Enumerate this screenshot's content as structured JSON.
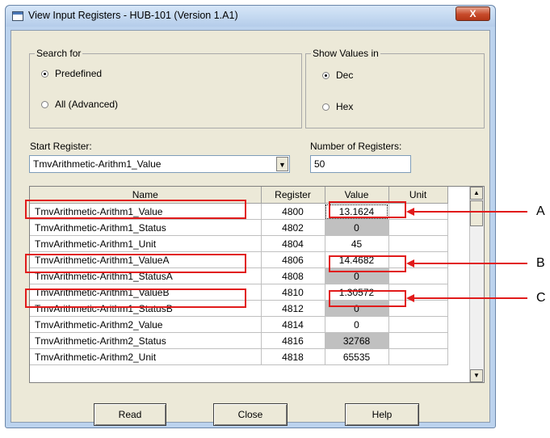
{
  "window": {
    "title": "View Input Registers - HUB-101 (Version 1.A1)",
    "close_glyph": "X"
  },
  "search_for": {
    "label": "Search for",
    "predefined_label": "Predefined",
    "all_label": "All (Advanced)",
    "selected": "Predefined"
  },
  "show_values": {
    "label": "Show Values in",
    "dec_label": "Dec",
    "hex_label": "Hex",
    "selected": "Dec"
  },
  "start_register": {
    "label": "Start Register:",
    "value": "TmvArithmetic-Arithm1_Value"
  },
  "num_registers": {
    "label": "Number of Registers:",
    "value": "50"
  },
  "table": {
    "headers": [
      "Name",
      "Register",
      "Value",
      "Unit"
    ],
    "rows": [
      {
        "name": "TmvArithmetic-Arithm1_Value",
        "register": "4800",
        "value": "13.1624",
        "unit": "",
        "grey": false
      },
      {
        "name": "TmvArithmetic-Arithm1_Status",
        "register": "4802",
        "value": "0",
        "unit": "",
        "grey": true
      },
      {
        "name": "TmvArithmetic-Arithm1_Unit",
        "register": "4804",
        "value": "45",
        "unit": "",
        "grey": false
      },
      {
        "name": "TmvArithmetic-Arithm1_ValueA",
        "register": "4806",
        "value": "14.4682",
        "unit": "",
        "grey": false
      },
      {
        "name": "TmvArithmetic-Arithm1_StatusA",
        "register": "4808",
        "value": "0",
        "unit": "",
        "grey": true
      },
      {
        "name": "TmvArithmetic-Arithm1_ValueB",
        "register": "4810",
        "value": "1.30572",
        "unit": "",
        "grey": false
      },
      {
        "name": "TmvArithmetic-Arithm1_StatusB",
        "register": "4812",
        "value": "0",
        "unit": "",
        "grey": true
      },
      {
        "name": "TmvArithmetic-Arithm2_Value",
        "register": "4814",
        "value": "0",
        "unit": "",
        "grey": false
      },
      {
        "name": "TmvArithmetic-Arithm2_Status",
        "register": "4816",
        "value": "32768",
        "unit": "",
        "grey": true
      },
      {
        "name": "TmvArithmetic-Arithm2_Unit",
        "register": "4818",
        "value": "65535",
        "unit": "",
        "grey": false
      }
    ]
  },
  "buttons": {
    "read": "Read",
    "close": "Close",
    "help": "Help"
  },
  "callouts": [
    "A",
    "B",
    "C"
  ],
  "colors": {
    "highlight": "#e11b1b",
    "status_cell": "#c0c0c0"
  }
}
